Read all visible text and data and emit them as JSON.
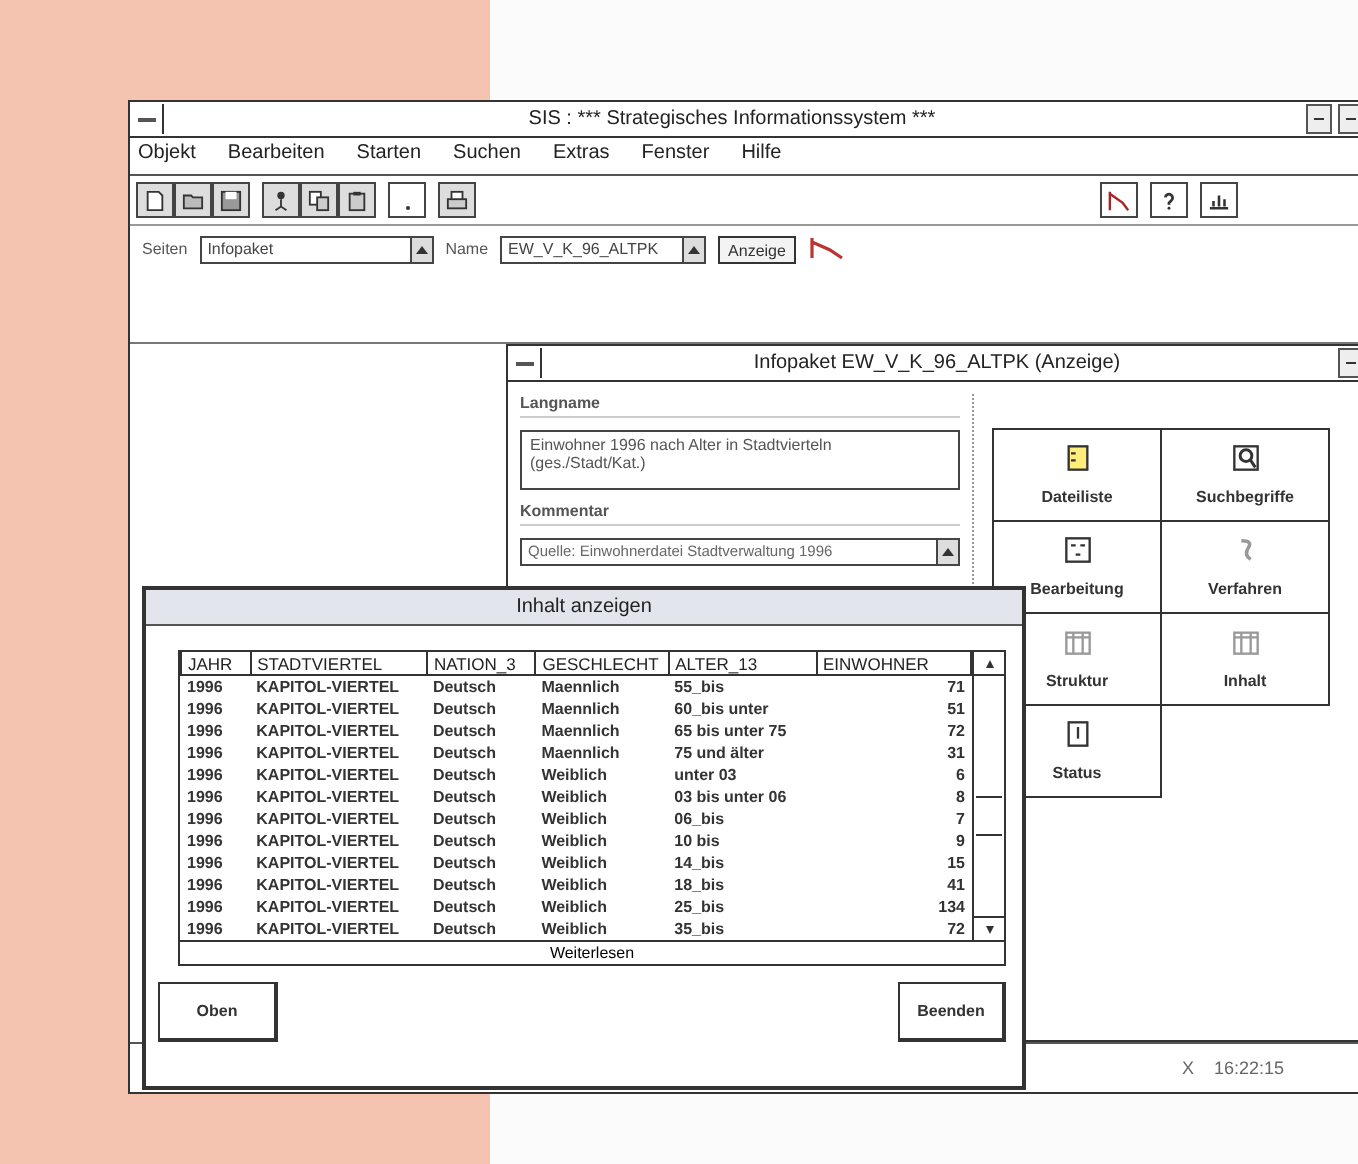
{
  "window": {
    "title": "SIS : *** Strategisches Informationssystem ***"
  },
  "menu": [
    {
      "label": "Objekt"
    },
    {
      "label": "Bearbeiten"
    },
    {
      "label": "Starten"
    },
    {
      "label": "Suchen"
    },
    {
      "label": "Extras"
    },
    {
      "label": "Fenster"
    },
    {
      "label": "Hilfe"
    }
  ],
  "selection": {
    "label_1": "Seiten",
    "combo_1": "Infopaket",
    "label_2": "Name",
    "combo_2": "EW_V_K_96_ALTPK",
    "button": "Anzeige"
  },
  "child_window": {
    "title": "Infopaket EW_V_K_96_ALTPK (Anzeige)",
    "fields": [
      {
        "label": "Langname",
        "value": "Einwohner 1996 nach Alter in Stadtvierteln (ges./Stadt/Kat.)",
        "kind": "memo"
      },
      {
        "label": "Kommentar",
        "value": "Quelle: Einwohnerdatei Stadtverwaltung 1996",
        "kind": "combo"
      }
    ],
    "tiles": [
      {
        "label": "Dateiliste",
        "kind": "list"
      },
      {
        "label": "Suchbegriffe",
        "kind": "search"
      },
      {
        "label": "Bearbeitung",
        "kind": "form"
      },
      {
        "label": "Verfahren",
        "kind": "squiggle"
      },
      {
        "label": "Struktur",
        "kind": "table"
      },
      {
        "label": "Inhalt",
        "kind": "table"
      },
      {
        "label": "Status",
        "kind": "door"
      }
    ]
  },
  "dialog": {
    "title": "Inhalt anzeigen",
    "columns": [
      "JAHR",
      "STADTVIERTEL",
      "NATION_3",
      "GESCHLECHT",
      "ALTER_13",
      "EINWOHNER"
    ],
    "rows": [
      [
        "1996",
        "KAPITOL-VIERTEL",
        "Deutsch",
        "Maennlich",
        "55_bis",
        "71"
      ],
      [
        "1996",
        "KAPITOL-VIERTEL",
        "Deutsch",
        "Maennlich",
        "60_bis unter",
        "51"
      ],
      [
        "1996",
        "KAPITOL-VIERTEL",
        "Deutsch",
        "Maennlich",
        "65 bis unter 75",
        "72"
      ],
      [
        "1996",
        "KAPITOL-VIERTEL",
        "Deutsch",
        "Maennlich",
        "75 und älter",
        "31"
      ],
      [
        "1996",
        "KAPITOL-VIERTEL",
        "Deutsch",
        "Weiblich",
        "unter 03",
        "6"
      ],
      [
        "1996",
        "KAPITOL-VIERTEL",
        "Deutsch",
        "Weiblich",
        "03 bis unter 06",
        "8"
      ],
      [
        "1996",
        "KAPITOL-VIERTEL",
        "Deutsch",
        "Weiblich",
        "06_bis",
        "7"
      ],
      [
        "1996",
        "KAPITOL-VIERTEL",
        "Deutsch",
        "Weiblich",
        "10 bis",
        "9"
      ],
      [
        "1996",
        "KAPITOL-VIERTEL",
        "Deutsch",
        "Weiblich",
        "14_bis",
        "15"
      ],
      [
        "1996",
        "KAPITOL-VIERTEL",
        "Deutsch",
        "Weiblich",
        "18_bis",
        "41"
      ],
      [
        "1996",
        "KAPITOL-VIERTEL",
        "Deutsch",
        "Weiblich",
        "25_bis",
        "134"
      ],
      [
        "1996",
        "KAPITOL-VIERTEL",
        "Deutsch",
        "Weiblich",
        "35_bis",
        "72"
      ]
    ],
    "more_button": "Weiterlesen",
    "buttons": [
      "Oben",
      "Beenden"
    ]
  },
  "status_bar": {
    "mark": "X",
    "time": "16:22:15"
  }
}
